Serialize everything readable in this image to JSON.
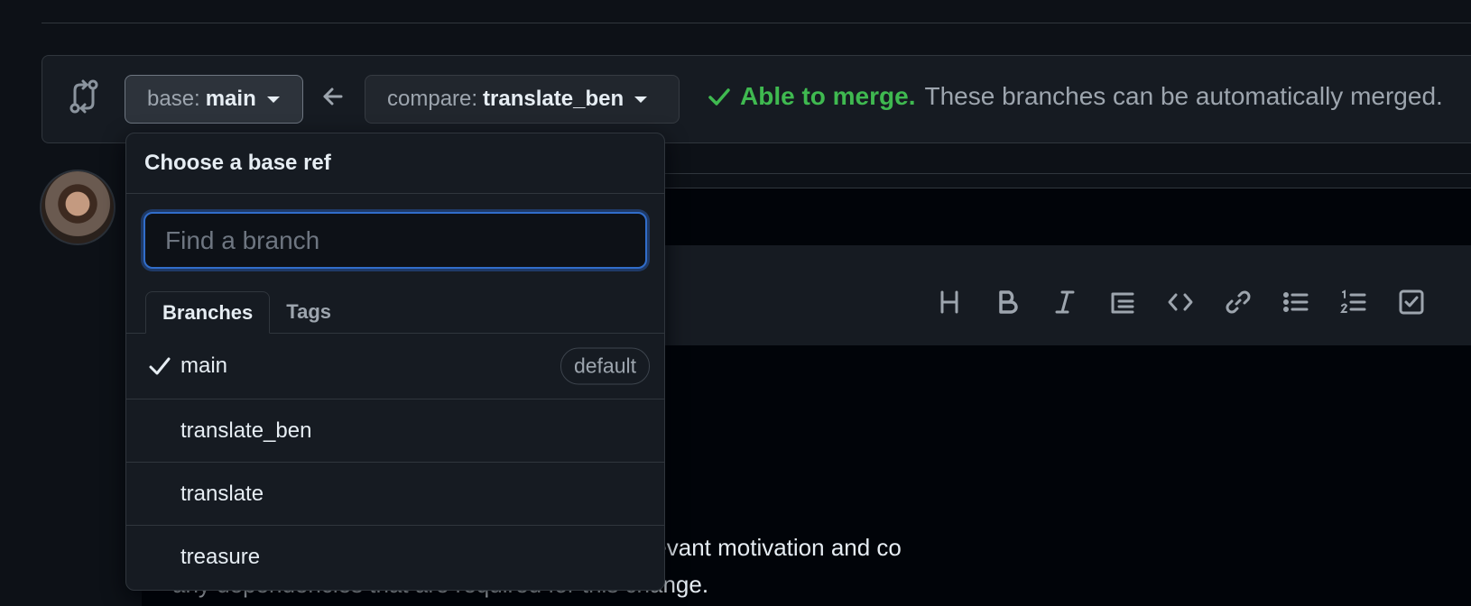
{
  "compare_bar": {
    "base_prefix": "base:",
    "base_value": "main",
    "compare_prefix": "compare:",
    "compare_value": "translate_ben",
    "merge_status": "Able to merge.",
    "merge_description": "These branches can be automatically merged."
  },
  "editor": {
    "toolbar_icons": [
      "heading-icon",
      "bold-icon",
      "italic-icon",
      "quote-icon",
      "code-icon",
      "link-icon",
      "bulleted-list-icon",
      "numbered-list-icon",
      "task-list-icon"
    ],
    "body_line1": "nd which issue is fixed. Please also include relevant motivation and co",
    "body_line2": "any dependencies that are required for this change."
  },
  "dropdown": {
    "title": "Choose a base ref",
    "search_placeholder": "Find a branch",
    "tabs": [
      "Branches",
      "Tags"
    ],
    "items": [
      {
        "label": "main",
        "selected": true,
        "badge": "default"
      },
      {
        "label": "translate_ben"
      },
      {
        "label": "translate"
      },
      {
        "label": "treasure"
      }
    ]
  },
  "colors": {
    "background": "#0d1117",
    "panel": "#161b22",
    "success": "#3fb950",
    "focus": "#316dca"
  }
}
